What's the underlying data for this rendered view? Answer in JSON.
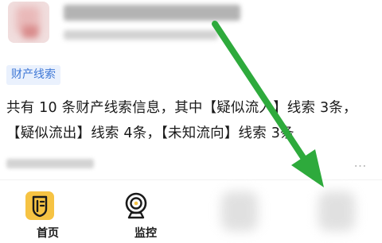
{
  "header": {
    "company_name": "",
    "company_sub": ""
  },
  "card": {
    "tag": "财产线索",
    "description": "共有 10 条财产线索信息，其中【疑似流入】线索 3条，【疑似流出】线索 4条，【未知流向】线索 3条",
    "more_icon": "…"
  },
  "nav": {
    "items": [
      {
        "label": "首页",
        "icon": "home-shield-icon"
      },
      {
        "label": "监控",
        "icon": "camera-icon"
      },
      {
        "label": "",
        "icon": "blurred-icon"
      },
      {
        "label": "",
        "icon": "blurred-icon"
      }
    ]
  },
  "overlay": {
    "arrow_color": "#2eaa3c"
  }
}
